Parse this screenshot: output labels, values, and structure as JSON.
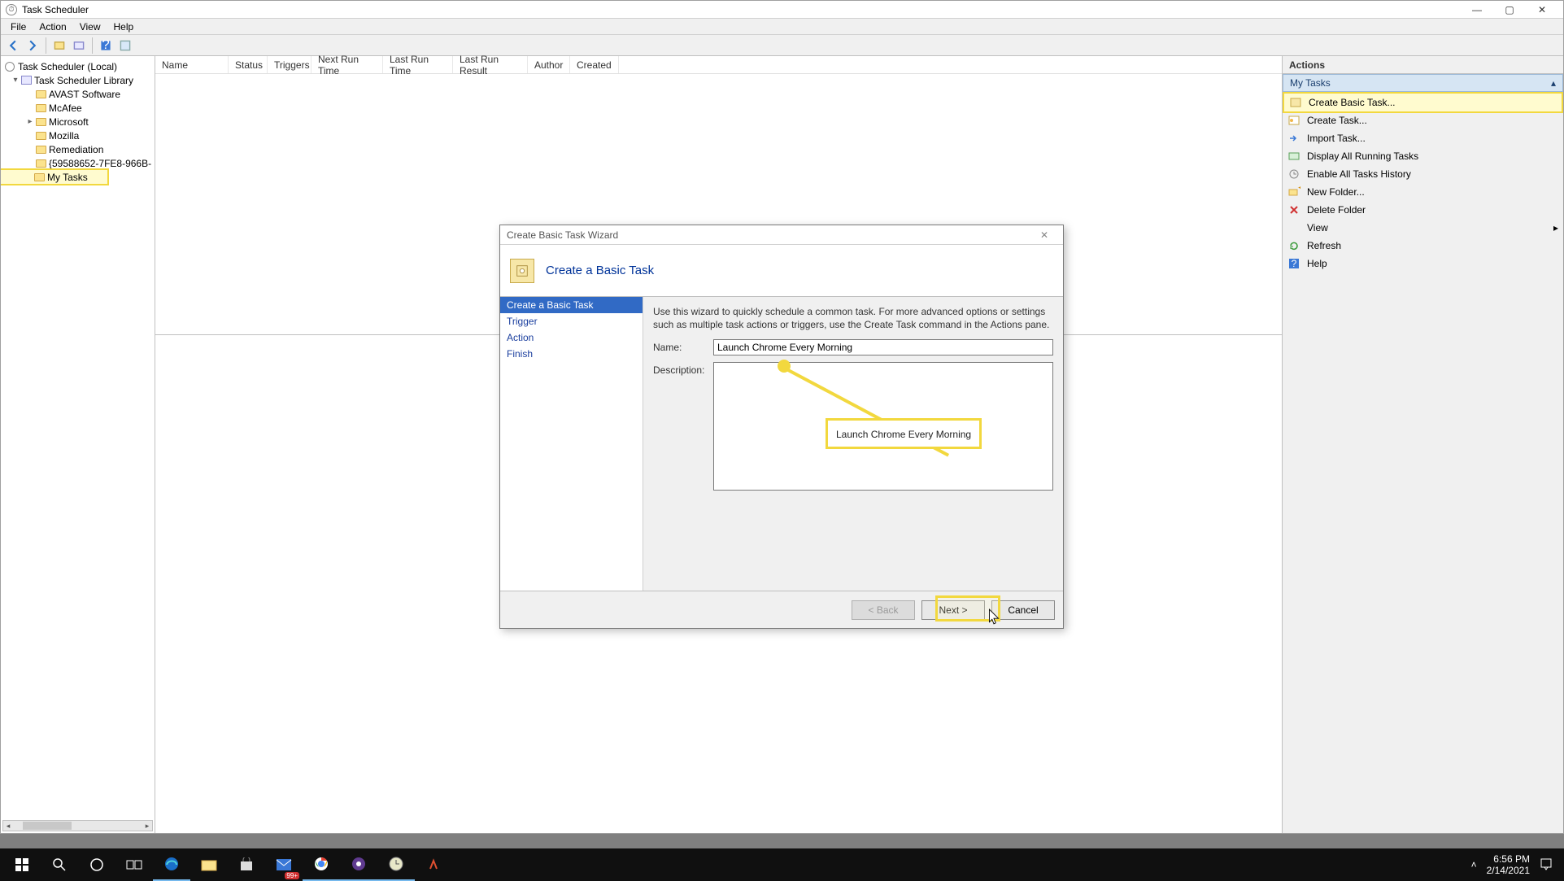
{
  "window": {
    "title": "Task Scheduler",
    "menu": {
      "file": "File",
      "action": "Action",
      "view": "View",
      "help": "Help"
    }
  },
  "tree": {
    "root": "Task Scheduler (Local)",
    "library": "Task Scheduler Library",
    "items": {
      "avast": "AVAST Software",
      "mcafee": "McAfee",
      "microsoft": "Microsoft",
      "mozilla": "Mozilla",
      "remediation": "Remediation",
      "guid": "{59588652-7FE8-966B-",
      "mytasks": "My Tasks"
    }
  },
  "columns": {
    "name": "Name",
    "status": "Status",
    "triggers": "Triggers",
    "nextrun": "Next Run Time",
    "lastrun": "Last Run Time",
    "lastresult": "Last Run Result",
    "author": "Author",
    "created": "Created"
  },
  "actions": {
    "header": "Actions",
    "section": "My Tasks",
    "rows": {
      "createBasic": "Create Basic Task...",
      "createTask": "Create Task...",
      "importTask": "Import Task...",
      "displayRunning": "Display All Running Tasks",
      "enableHistory": "Enable All Tasks History",
      "newFolder": "New Folder...",
      "deleteFolder": "Delete Folder",
      "view": "View",
      "refresh": "Refresh",
      "help": "Help"
    }
  },
  "dialog": {
    "title": "Create Basic Task Wizard",
    "header": "Create a Basic Task",
    "nav": {
      "createBasic": "Create a Basic Task",
      "trigger": "Trigger",
      "action": "Action",
      "finish": "Finish"
    },
    "intro": "Use this wizard to quickly schedule a common task. For more advanced options or settings such as multiple task actions or triggers, use the Create Task command in the Actions pane.",
    "labels": {
      "name": "Name:",
      "description": "Description:"
    },
    "fields": {
      "name": "Launch Chrome Every Morning",
      "description": ""
    },
    "buttons": {
      "back": "< Back",
      "next": "Next >",
      "cancel": "Cancel"
    }
  },
  "annotation": {
    "callout": "Launch Chrome Every Morning"
  },
  "taskbar": {
    "time": "6:56 PM",
    "date": "2/14/2021",
    "badge": "99+"
  }
}
